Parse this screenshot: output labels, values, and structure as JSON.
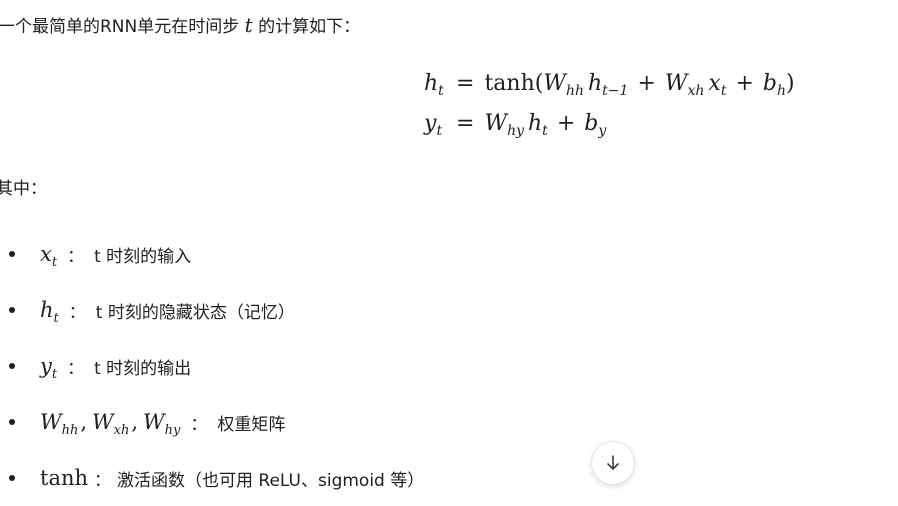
{
  "intro": {
    "before": "一个最简单的RNN单元在时间步 ",
    "var": "t",
    "after": " 的计算如下："
  },
  "equations": [
    {
      "lhs_sym": "h",
      "lhs_sub": "t",
      "eq": "=",
      "parts": [
        "tanh(",
        "W",
        "hh",
        "h",
        "t−1",
        "+",
        "W",
        "xh",
        "x",
        "t",
        "+",
        "b",
        "h",
        ")"
      ]
    },
    {
      "lhs_sym": "y",
      "lhs_sub": "t",
      "eq": "=",
      "parts": [
        "W",
        "hy",
        "h",
        "t",
        "+",
        "b",
        "y"
      ]
    }
  ],
  "where_label": "其中：",
  "bullets": [
    {
      "sym": "x",
      "sub": "t",
      "sep": "：",
      "text": "t 时刻的输入"
    },
    {
      "sym": "h",
      "sub": "t",
      "sep": "：",
      "text": "t 时刻的隐藏状态（记忆）"
    },
    {
      "sym": "y",
      "sub": "t",
      "sep": "：",
      "text": "t 时刻的输出"
    },
    {
      "syms": [
        [
          "W",
          "hh"
        ],
        [
          "W",
          "xh"
        ],
        [
          "W",
          "hy"
        ]
      ],
      "comma": ",",
      "sep": "：",
      "text": "权重矩阵"
    },
    {
      "fn": "tanh",
      "sep": "：",
      "text": "激活函数（也可用 ReLU、sigmoid 等）"
    }
  ],
  "scroll_button": {
    "icon": "arrow-down-icon"
  }
}
